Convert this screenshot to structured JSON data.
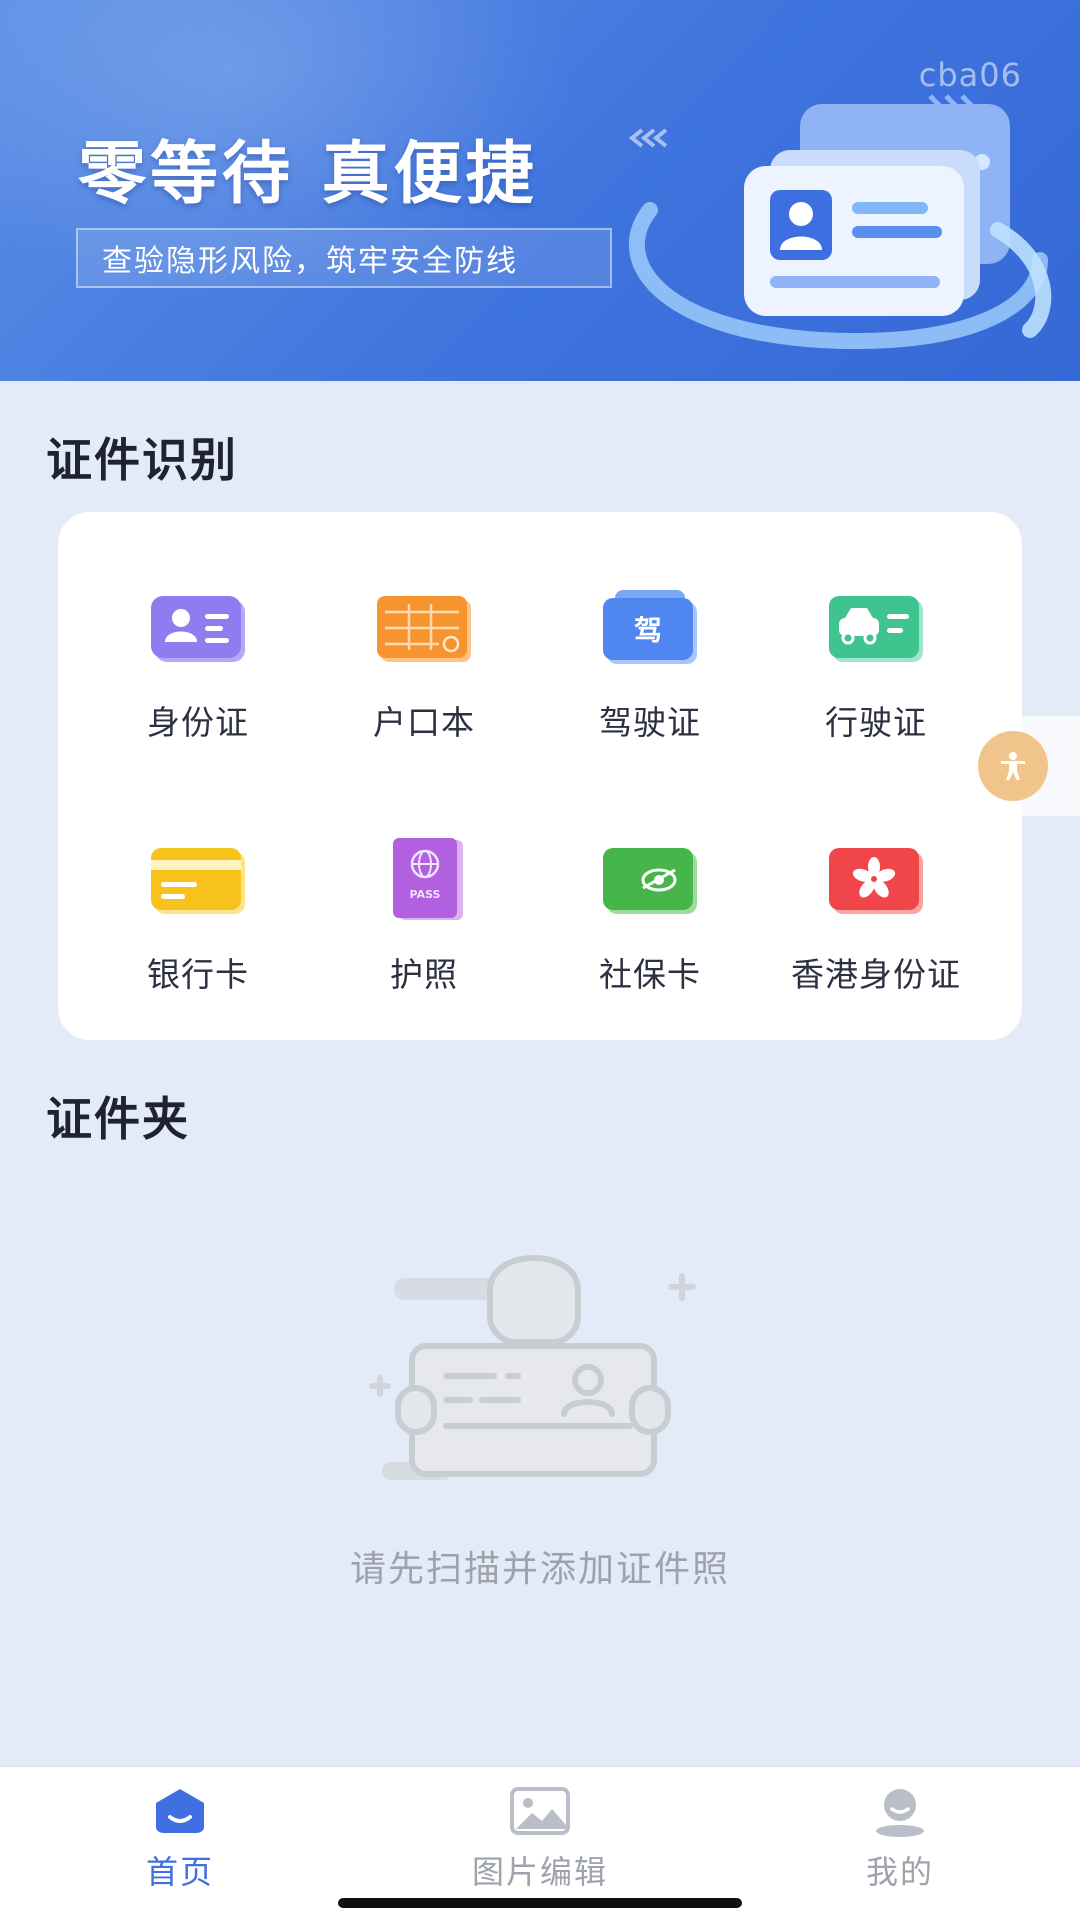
{
  "colors": {
    "accent": "#3f6fe0",
    "nav_inactive": "#9ea2ab",
    "background": "#e3ebf8"
  },
  "banner": {
    "title": "零等待 真便捷",
    "subtitle": "查验隐形风险，筑牢安全防线",
    "tag": "cba06"
  },
  "recognition": {
    "title": "证件识别",
    "items": [
      {
        "label": "身份证",
        "icon": "id-card-icon"
      },
      {
        "label": "户口本",
        "icon": "household-register-icon"
      },
      {
        "label": "驾驶证",
        "icon": "driver-license-icon",
        "glyph": "驾"
      },
      {
        "label": "行驶证",
        "icon": "vehicle-license-icon"
      },
      {
        "label": "银行卡",
        "icon": "bank-card-icon"
      },
      {
        "label": "护照",
        "icon": "passport-icon",
        "glyph": "PASS"
      },
      {
        "label": "社保卡",
        "icon": "social-security-card-icon"
      },
      {
        "label": "香港身份证",
        "icon": "hk-id-card-icon"
      }
    ]
  },
  "folder": {
    "title": "证件夹",
    "empty_text": "请先扫描并添加证件照"
  },
  "nav": {
    "items": [
      {
        "label": "首页",
        "icon": "home-icon",
        "active": true
      },
      {
        "label": "图片编辑",
        "icon": "image-edit-icon",
        "active": false
      },
      {
        "label": "我的",
        "icon": "profile-icon",
        "active": false
      }
    ]
  }
}
